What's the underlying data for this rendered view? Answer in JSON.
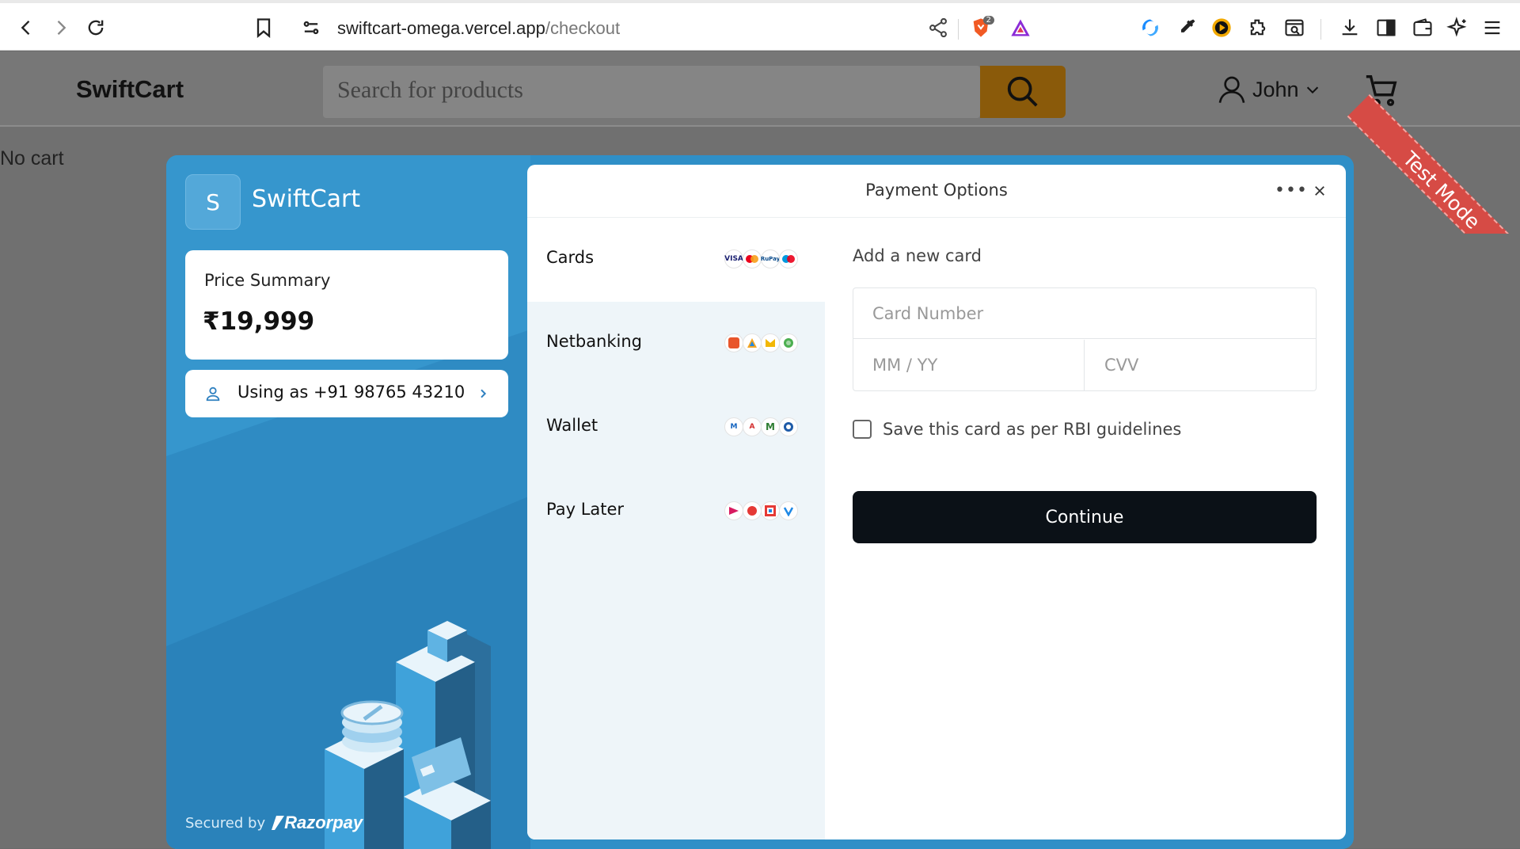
{
  "browser": {
    "url_host": "swiftcart-omega.vercel.app",
    "url_path": "/checkout",
    "brave_badge": "2"
  },
  "site": {
    "brand": "SwiftCart",
    "search_placeholder": "Search for products",
    "user_name": "John",
    "empty_cart_text": "No cart",
    "ribbon_text": "Test Mode"
  },
  "checkout": {
    "merchant_initial": "S",
    "merchant_name": "SwiftCart",
    "price_summary_label": "Price Summary",
    "price_amount": "₹19,999",
    "contact_text": "Using as +91 98765 43210",
    "secured_by": "Secured by",
    "provider": "Razorpay",
    "title": "Payment Options",
    "methods": [
      {
        "label": "Cards",
        "icons": [
          "visa-icon",
          "mastercard-icon",
          "rupay-icon",
          "maestro-icon"
        ]
      },
      {
        "label": "Netbanking",
        "icons": [
          "bank-1-icon",
          "bank-2-icon",
          "bank-3-icon",
          "bank-4-icon"
        ]
      },
      {
        "label": "Wallet",
        "icons": [
          "wallet-1-icon",
          "wallet-2-icon",
          "wallet-3-icon",
          "wallet-4-icon"
        ]
      },
      {
        "label": "Pay Later",
        "icons": [
          "paylater-1-icon",
          "paylater-2-icon",
          "paylater-3-icon",
          "paylater-4-icon"
        ]
      }
    ],
    "card_form": {
      "title": "Add a new card",
      "card_number_placeholder": "Card Number",
      "expiry_placeholder": "MM / YY",
      "cvv_placeholder": "CVV",
      "save_label": "Save this card as per RBI guidelines",
      "continue_label": "Continue"
    }
  }
}
